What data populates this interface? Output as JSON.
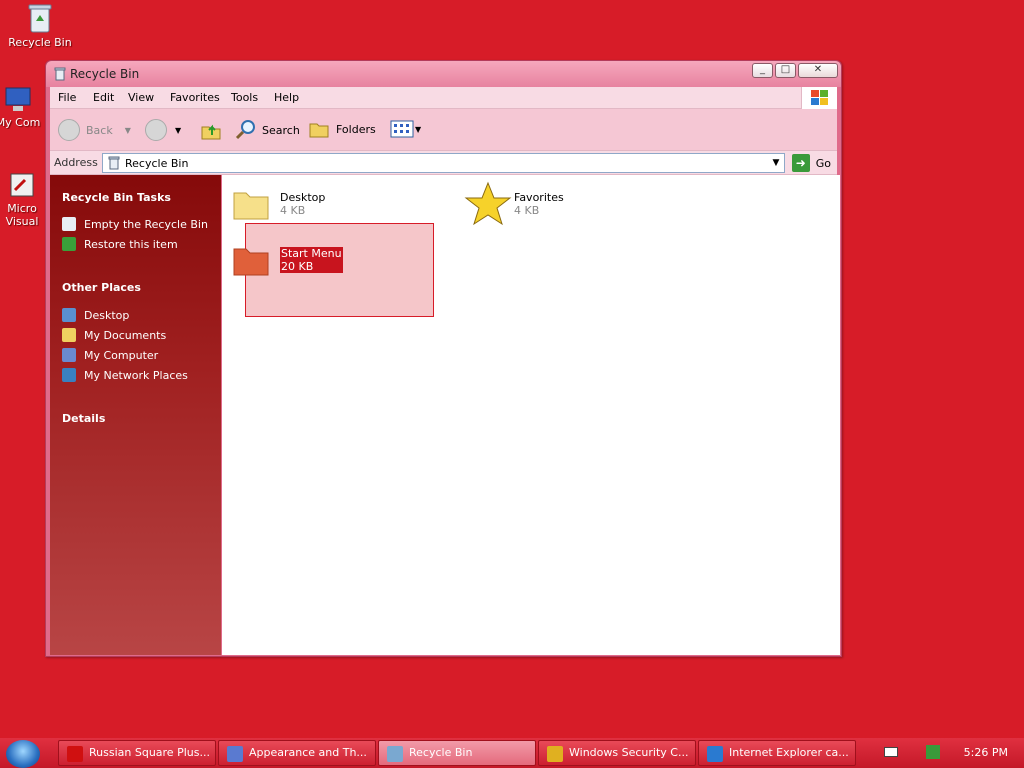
{
  "desktop": {
    "icons": [
      {
        "label": "Recycle Bin"
      },
      {
        "label": "My Com"
      },
      {
        "label": "Micro\nVisual"
      }
    ]
  },
  "window": {
    "title": "Recycle Bin",
    "controls": {
      "minimize": "_",
      "maximize": "□",
      "close": "✕"
    },
    "menu": [
      "File",
      "Edit",
      "View",
      "Favorites",
      "Tools",
      "Help"
    ],
    "toolbar": {
      "back": "Back",
      "search": "Search",
      "folders": "Folders"
    },
    "address": {
      "label": "Address",
      "value": "Recycle Bin",
      "go": "Go"
    }
  },
  "taskpane": {
    "sections": [
      {
        "title": "Recycle Bin Tasks",
        "items": [
          "Empty the Recycle Bin",
          "Restore this item"
        ]
      },
      {
        "title": "Other Places",
        "items": [
          "Desktop",
          "My Documents",
          "My Computer",
          "My Network Places"
        ]
      },
      {
        "title": "Details",
        "items": []
      }
    ]
  },
  "content": {
    "items": [
      {
        "name": "Desktop",
        "size": "4 KB",
        "icon": "folder-icon"
      },
      {
        "name": "Favorites",
        "size": "4 KB",
        "icon": "star-icon"
      },
      {
        "name": "Start Menu",
        "size": "20 KB",
        "icon": "folder-icon",
        "selected": true
      }
    ]
  },
  "taskbar": {
    "buttons": [
      {
        "label": "Russian Square Plus...",
        "color": "#d01010"
      },
      {
        "label": "Appearance and Th...",
        "color": "#5a7ad0"
      },
      {
        "label": "Recycle Bin",
        "color": "#7aa8d0",
        "active": true
      },
      {
        "label": "Windows Security C...",
        "color": "#e0b020"
      },
      {
        "label": "Internet Explorer ca...",
        "color": "#2a7ad0"
      }
    ],
    "clock": "5:26 PM"
  }
}
